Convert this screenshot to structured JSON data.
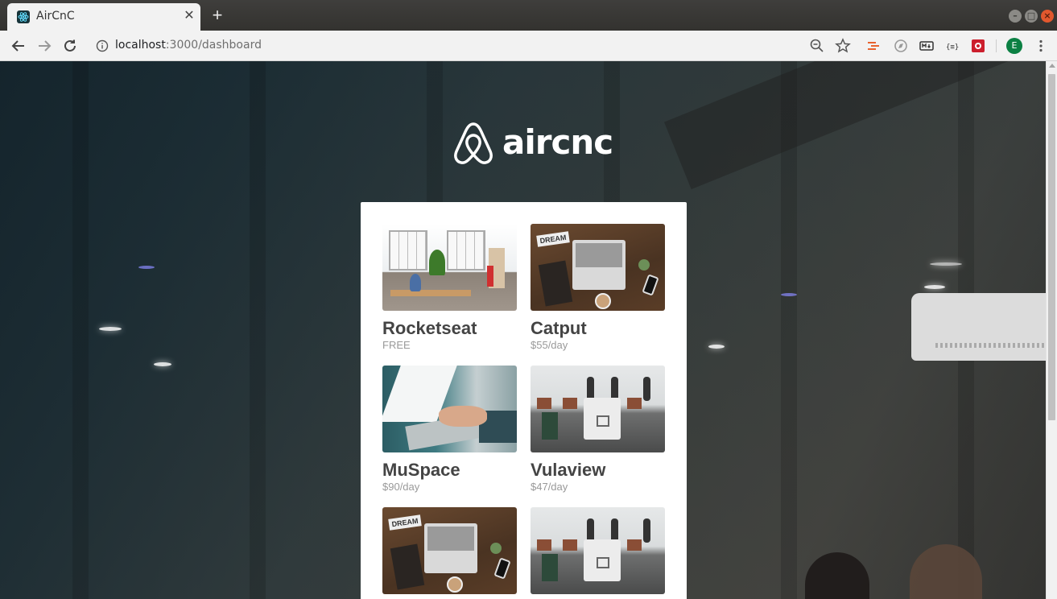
{
  "browser": {
    "tab_title": "AirCnC",
    "tab_close": "✕",
    "new_tab": "+",
    "url_host": "localhost",
    "url_path": ":3000/dashboard",
    "avatar_letter": "E",
    "window_buttons": {
      "minimize": "–",
      "maximize": "□",
      "close": "×"
    }
  },
  "app": {
    "logo_text": "aircnc",
    "brand_color": "#ffffff",
    "spots": [
      {
        "name": "Rocketseat",
        "price": "FREE",
        "image": "office-photo"
      },
      {
        "name": "Catput",
        "price": "$55/day",
        "image": "desk-laptop-photo"
      },
      {
        "name": "MuSpace",
        "price": "$90/day",
        "image": "typing-laptop-photo"
      },
      {
        "name": "Vulaview",
        "price": "$47/day",
        "image": "cafe-counter-photo"
      },
      {
        "name": "",
        "price": "",
        "image": "desk-laptop-photo"
      },
      {
        "name": "",
        "price": "",
        "image": "cafe-counter-photo"
      }
    ]
  },
  "icons": {
    "back": "arrow-left-icon",
    "forward": "arrow-right-icon",
    "reload": "reload-icon",
    "info": "info-icon",
    "zoom": "zoom-out-icon",
    "bookmark": "star-icon",
    "menu": "kebab-menu-icon"
  }
}
